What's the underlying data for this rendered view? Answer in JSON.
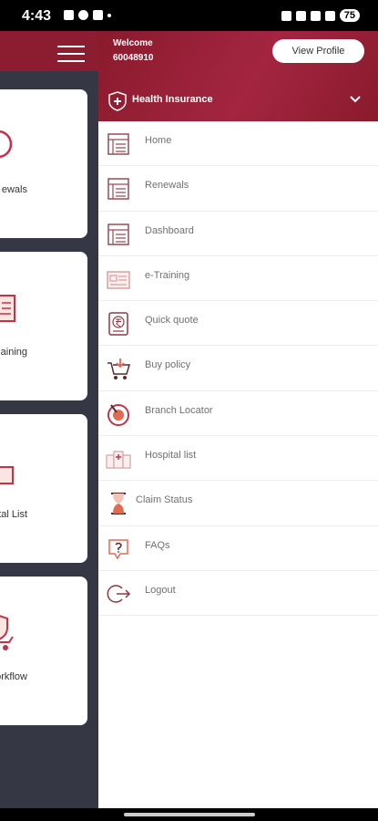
{
  "status_bar": {
    "time": "4:43",
    "battery": "75"
  },
  "background_cards": [
    {
      "label": "ewals"
    },
    {
      "label": "aining"
    },
    {
      "label": "tal List"
    },
    {
      "label": "orkflow"
    }
  ],
  "drawer": {
    "welcome": "Welcome",
    "user_id": "60048910",
    "view_profile": "View Profile",
    "section": "Health Insurance",
    "menu": [
      {
        "label": "Home",
        "icon": "home-icon"
      },
      {
        "label": "Renewals",
        "icon": "renewals-icon"
      },
      {
        "label": "Dashboard",
        "icon": "dashboard-icon"
      },
      {
        "label": "e-Training",
        "icon": "training-icon"
      },
      {
        "label": "Quick quote",
        "icon": "rupee-icon"
      },
      {
        "label": "Buy policy",
        "icon": "cart-icon"
      },
      {
        "label": "Branch Locator",
        "icon": "locator-icon"
      },
      {
        "label": "Hospital list",
        "icon": "hospital-icon"
      },
      {
        "label": "Claim Status",
        "icon": "hourglass-icon"
      },
      {
        "label": "FAQs",
        "icon": "faq-icon"
      },
      {
        "label": "Logout",
        "icon": "logout-icon"
      }
    ]
  },
  "colors": {
    "brand": "#8c1d30",
    "accent": "#c2334a",
    "overlay": "#353844"
  }
}
